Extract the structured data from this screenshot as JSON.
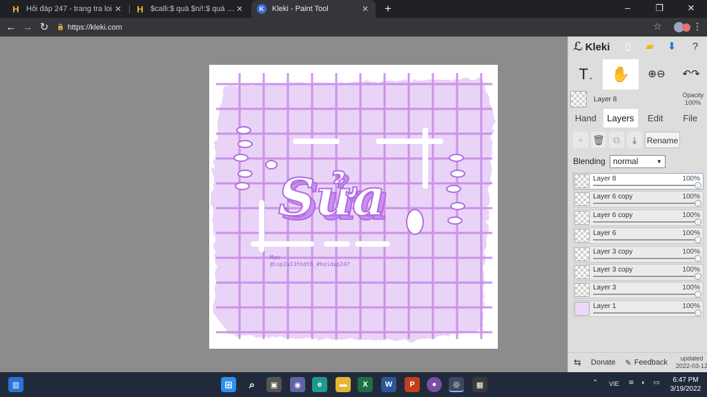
{
  "browser": {
    "tabs": [
      {
        "title": "Hỏi đáp 247 - trang tra loi",
        "favicon": "hoidap-favicon",
        "active": false
      },
      {
        "title": "$calli:$ quà $n/!:$ quà to thế mn",
        "favicon": "hoidap-favicon",
        "active": false
      },
      {
        "title": "Kleki - Paint Tool",
        "favicon": "kleki-favicon",
        "active": true
      }
    ],
    "url": "https://kleki.com"
  },
  "app": {
    "logo_text": "Kleki",
    "current_layer": "Layer 8",
    "opacity_label": "Opacity",
    "opacity_value": "100%",
    "tabs": [
      "Hand",
      "Layers",
      "Edit",
      "File"
    ],
    "active_tab": "Layers",
    "rename_label": "Rename",
    "blending_label": "Blending",
    "blending_value": "normal",
    "layers": [
      {
        "name": "Layer 8",
        "opacity": "100%",
        "selected": true
      },
      {
        "name": "Layer 6 copy",
        "opacity": "100%",
        "selected": false
      },
      {
        "name": "Layer 6 copy",
        "opacity": "100%",
        "selected": false
      },
      {
        "name": "Layer 6",
        "opacity": "100%",
        "selected": false
      },
      {
        "name": "Layer 3 copy",
        "opacity": "100%",
        "selected": false
      },
      {
        "name": "Layer 3 copy",
        "opacity": "100%",
        "selected": false
      },
      {
        "name": "Layer 3",
        "opacity": "100%",
        "selected": false
      },
      {
        "name": "Layer 1",
        "opacity": "100%",
        "selected": false
      }
    ],
    "bottom": {
      "donate": "Donate",
      "feedback": "Feedback",
      "updated_label": "updated",
      "updated_date": "2022-03-12"
    }
  },
  "artwork": {
    "main_word": "Sửa",
    "credit_line1": "Mun",
    "credit_line2": "@lop2a13thdth_#hoidap247"
  },
  "taskbar": {
    "lang": "VIE",
    "time": "6:47 PM",
    "date": "3/19/2022"
  },
  "colors": {
    "lavender": "#e9d3f7",
    "grid": "#c88be8",
    "accent": "#b06ce0"
  }
}
